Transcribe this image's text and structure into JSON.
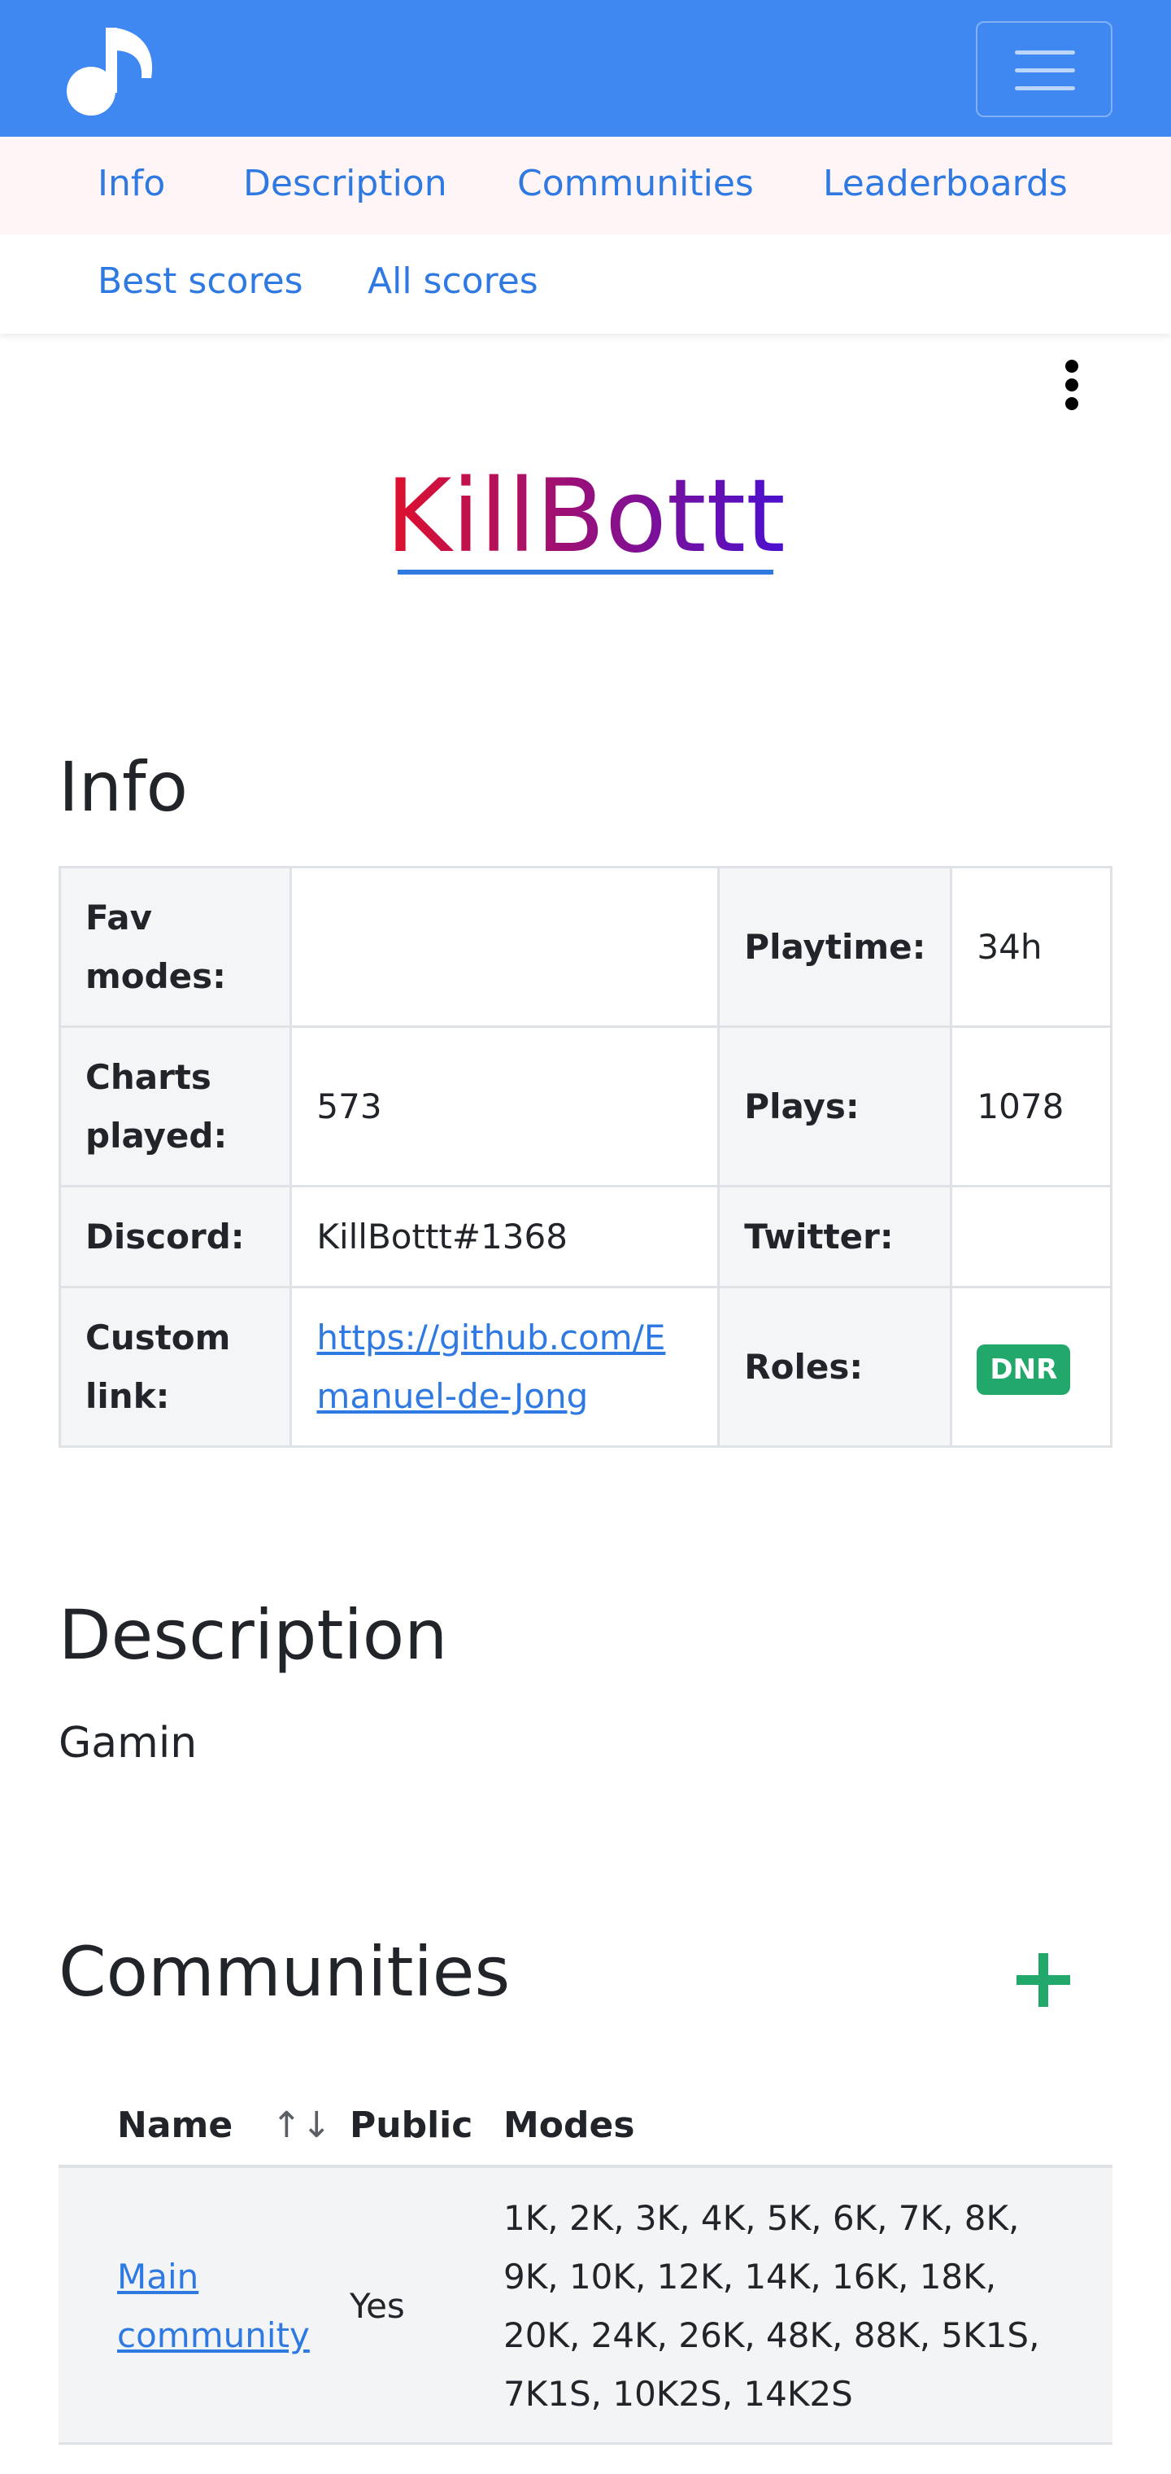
{
  "navbar": {
    "logo_icon": "music-note-icon",
    "menu_icon": "hamburger-icon",
    "brand_color": "#3f88f2"
  },
  "subnav": {
    "links": [
      "Info",
      "Description",
      "Communities",
      "Leaderboards",
      "Best scores",
      "All scores"
    ]
  },
  "profile": {
    "username": "KillBottt",
    "more_icon": "kebab-menu-icon"
  },
  "info": {
    "heading": "Info",
    "rows": [
      {
        "k1": "Fav modes:",
        "v1": "",
        "k2": "Playtime:",
        "v2": "34h"
      },
      {
        "k1": "Charts played:",
        "v1": "573",
        "k2": "Plays:",
        "v2": "1078"
      },
      {
        "k1": "Discord:",
        "v1": "KillBottt#1368",
        "k2": "Twitter:",
        "v2": ""
      },
      {
        "k1": "Custom link:",
        "v1": "https://github.com/Emanuel-de-Jong",
        "k2": "Roles:",
        "v2": "DNR"
      }
    ]
  },
  "description": {
    "heading": "Description",
    "text": "Gamin"
  },
  "communities": {
    "heading": "Communities",
    "add_icon": "plus-icon",
    "columns": [
      "Name",
      "Public",
      "Modes"
    ],
    "sort_icon": "↑↓",
    "rows": [
      {
        "name": "Main community",
        "public": "Yes",
        "modes": "1K, 2K, 3K, 4K, 5K, 6K, 7K, 8K, 9K, 10K, 12K, 14K, 16K, 18K, 20K, 24K, 26K, 48K, 88K, 5K1S, 7K1S, 10K2S, 14K2S"
      }
    ]
  },
  "colors": {
    "link": "#2f79e3",
    "success": "#22a86a",
    "title_gradient_start": "#e0102b",
    "title_gradient_end": "#4a10d0"
  }
}
